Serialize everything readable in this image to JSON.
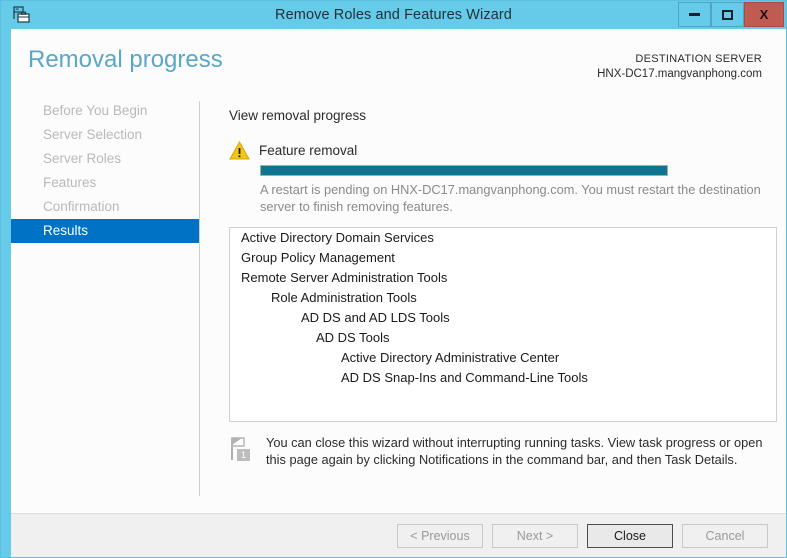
{
  "window": {
    "title": "Remove Roles and Features Wizard",
    "icon": "server-wizard-icon",
    "controls": {
      "minimize": "minimize-icon",
      "maximize": "maximize-icon",
      "close": "X"
    }
  },
  "header": {
    "page_title": "Removal progress",
    "destination_label": "DESTINATION SERVER",
    "destination_server": "HNX-DC17.mangvanphong.com"
  },
  "sidebar": {
    "items": [
      {
        "label": "Before You Begin",
        "active": false
      },
      {
        "label": "Server Selection",
        "active": false
      },
      {
        "label": "Server Roles",
        "active": false
      },
      {
        "label": "Features",
        "active": false
      },
      {
        "label": "Confirmation",
        "active": false
      },
      {
        "label": "Results",
        "active": true
      }
    ]
  },
  "main": {
    "section_label": "View removal progress",
    "status_icon": "warning-triangle-icon",
    "status_label": "Feature removal",
    "progress_percent": 100,
    "restart_message": "A restart is pending on HNX-DC17.mangvanphong.com. You must restart the destination server to finish removing features.",
    "removed_items": [
      {
        "label": "Active Directory Domain Services",
        "level": 0
      },
      {
        "label": "Group Policy Management",
        "level": 0
      },
      {
        "label": "Remote Server Administration Tools",
        "level": 0
      },
      {
        "label": "Role Administration Tools",
        "level": 1
      },
      {
        "label": "AD DS and AD LDS Tools",
        "level": 2
      },
      {
        "label": "AD DS Tools",
        "level": 3
      },
      {
        "label": "Active Directory Administrative Center",
        "level": 4
      },
      {
        "label": "AD DS Snap-Ins and Command-Line Tools",
        "level": 4
      }
    ],
    "note_icon": "notification-flag-icon",
    "note_badge": "1",
    "note_text": "You can close this wizard without interrupting running tasks. View task progress or open this page again by clicking Notifications in the command bar, and then Task Details."
  },
  "footer": {
    "previous_label": "< Previous",
    "next_label": "Next >",
    "close_label": "Close",
    "cancel_label": "Cancel"
  },
  "colors": {
    "titlebar": "#66cbe8",
    "close_button": "#c05b52",
    "accent_blue": "#0072c6",
    "title_text_blue": "#5ba7c9",
    "progress_fill": "#0e7490",
    "warning_yellow": "#f5c518"
  }
}
